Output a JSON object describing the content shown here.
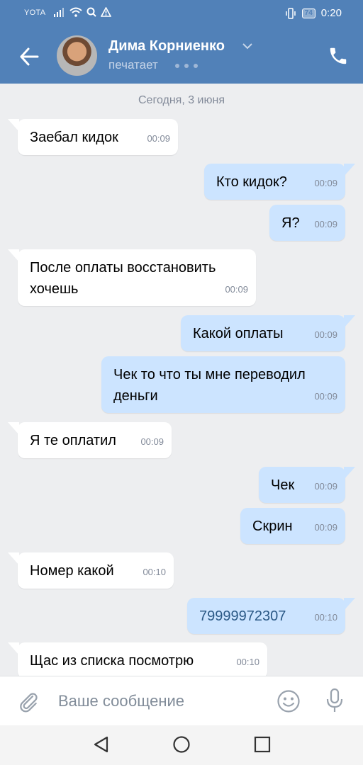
{
  "status_bar": {
    "carrier": "YOTA",
    "battery": "74",
    "time": "0:20"
  },
  "header": {
    "contact_name": "Дима Корниенко",
    "status": "печатает"
  },
  "date_separator": "Сегодня, 3 июня",
  "messages": [
    {
      "side": "in",
      "text": "Заебал кидок",
      "time": "00:09"
    },
    {
      "side": "out",
      "text": "Кто кидок?",
      "time": "00:09"
    },
    {
      "side": "out",
      "text": "Я?",
      "time": "00:09"
    },
    {
      "side": "in",
      "text": "После оплаты восстановить хочешь",
      "time": "00:09"
    },
    {
      "side": "out",
      "text": "Какой оплаты",
      "time": "00:09"
    },
    {
      "side": "out",
      "text": "Чек то что ты мне переводил деньги",
      "time": "00:09"
    },
    {
      "side": "in",
      "text": "Я те оплатил",
      "time": "00:09"
    },
    {
      "side": "out",
      "text": "Чек",
      "time": "00:09"
    },
    {
      "side": "out",
      "text": "Скрин",
      "time": "00:09"
    },
    {
      "side": "in",
      "text": "Номер какой",
      "time": "00:10"
    },
    {
      "side": "out",
      "text": "79999972307",
      "time": "00:10"
    },
    {
      "side": "in",
      "text": "Щас из списка посмотрю",
      "time": "00:10"
    }
  ],
  "composer": {
    "placeholder": "Ваше сообщение"
  },
  "icons": {
    "back": "arrow-left-icon",
    "phone": "phone-icon",
    "attach": "paperclip-icon",
    "emoji": "smile-icon",
    "mic": "microphone-icon"
  },
  "colors": {
    "header": "#5181b8",
    "outgoing_bubble": "#cce4ff",
    "incoming_bubble": "#ffffff",
    "background": "#edeef0"
  }
}
